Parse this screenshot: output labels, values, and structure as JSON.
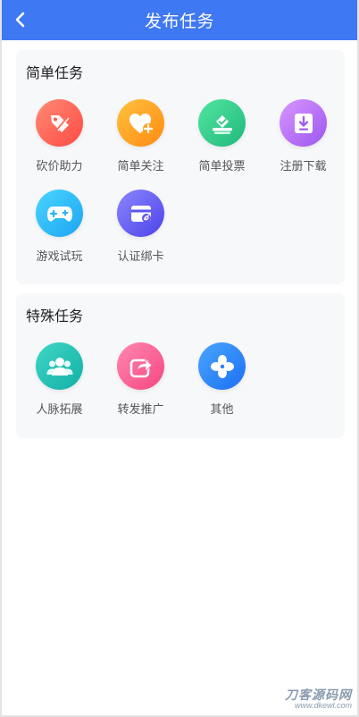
{
  "header": {
    "title": "发布任务"
  },
  "sections": [
    {
      "title": "简单任务",
      "items": [
        {
          "label": "砍价助力",
          "icon": "price-tag-icon",
          "color_from": "#ff8a73",
          "color_to": "#ff4b44"
        },
        {
          "label": "简单关注",
          "icon": "heart-plus-icon",
          "color_from": "#ffc23f",
          "color_to": "#ff8a12"
        },
        {
          "label": "简单投票",
          "icon": "vote-box-icon",
          "color_from": "#53e5a0",
          "color_to": "#1fb87c"
        },
        {
          "label": "注册下载",
          "icon": "download-icon",
          "color_from": "#d996ff",
          "color_to": "#9b56ee"
        },
        {
          "label": "游戏试玩",
          "icon": "gamepad-icon",
          "color_from": "#48d5ff",
          "color_to": "#1ea5f2"
        },
        {
          "label": "认证绑卡",
          "icon": "card-link-icon",
          "color_from": "#8c86ff",
          "color_to": "#4c43e8"
        }
      ]
    },
    {
      "title": "特殊任务",
      "items": [
        {
          "label": "人脉拓展",
          "icon": "people-icon",
          "color_from": "#3ed6c6",
          "color_to": "#14b0a6"
        },
        {
          "label": "转发推广",
          "icon": "share-icon",
          "color_from": "#ff88b2",
          "color_to": "#f5467f"
        },
        {
          "label": "其他",
          "icon": "clover-icon",
          "color_from": "#4aa6ff",
          "color_to": "#1c6ff3"
        }
      ]
    }
  ],
  "watermark": {
    "main": "刀客源码网",
    "sub": "www.dkewl.com"
  }
}
